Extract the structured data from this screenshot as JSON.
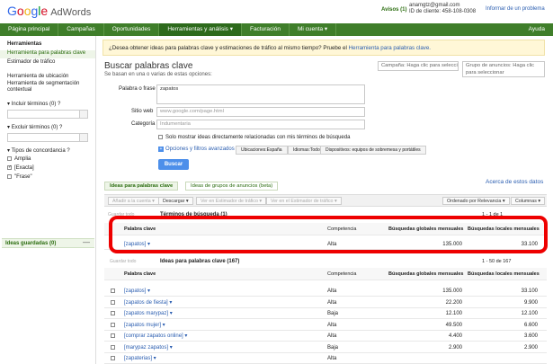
{
  "header": {
    "logo_google": [
      "G",
      "o",
      "o",
      "g",
      "l",
      "e"
    ],
    "logo_product": "AdWords",
    "notices": "Avisos (1)",
    "user_email": "anamgtz@gmail.com",
    "client_id": "ID de cliente: 458-108-0308",
    "report_issue": "Informar de un problema"
  },
  "nav": [
    "Página principal",
    "Campañas",
    "Oportunidades",
    "Herramientas y análisis ▾",
    "Facturación",
    "Mi cuenta ▾",
    "Ayuda"
  ],
  "sidebar": {
    "section_title": "Herramientas",
    "items": [
      "Herramienta para palabras clave",
      "Estimador de tráfico",
      "Herramienta de ubicación",
      "Herramienta de segmentación contextual"
    ],
    "include_terms": "Incluir términos (0)",
    "exclude_terms": "Excluir términos (0)",
    "match_types_title": "Tipos de concordancia",
    "match_types": [
      {
        "label": "Amplia",
        "checked": false
      },
      {
        "label": "[Exacta]",
        "checked": true
      },
      {
        "label": "\"Frase\"",
        "checked": false
      }
    ],
    "saved_ideas": "Ideas guardadas (0)"
  },
  "banner": {
    "text": "¿Desea obtener ideas para palabras clave y estimaciones de tráfico al mismo tiempo? Pruebe el ",
    "link": "Herramienta para palabras clave."
  },
  "campaign_select": "Campaña: Haga clic para seleccionar",
  "adgroup_select": "Grupo de anuncios: Haga clic para seleccionar",
  "search": {
    "title": "Buscar palabras clave",
    "subtitle": "Se basan en una o varias de estas opciones:",
    "keyword_label": "Palabra o frase",
    "keyword_value": "zapatos",
    "website_label": "Sitio web",
    "website_placeholder": "www.google.com/page.html",
    "category_label": "Categoría",
    "category_placeholder": "Indumentaria",
    "only_related": "Solo mostrar ideas directamente relacionadas con mis términos de búsqueda",
    "advanced": "Opciones y filtros avanzados",
    "location_chip": "Ubicaciones:España",
    "language_chip": "Idiomas:Todo",
    "devices_chip": "Dispositivos: equipos de sobremesa y portátiles",
    "button": "Buscar"
  },
  "tabs": {
    "ideas": "Ideas para palabras clave",
    "groups": "Ideas de grupos de anuncios (beta)",
    "about": "Acerca de estos datos"
  },
  "toolbar": {
    "add": "Añadir a la cuenta ▾",
    "download": "Descargar ▾",
    "see_search": "Ver en Estimador de tráfico ▾",
    "see_estimator": "Ver en el Estimador de tráfico ▾",
    "sort": "Ordenado por Relevancia ▾",
    "columns": "Columnas ▾"
  },
  "search_terms": {
    "save_all": "Guardar todo",
    "title": "Términos de búsqueda (1)",
    "pagination": "1 - 1 de 1",
    "columns": [
      "Palabra clave",
      "Competencia",
      "Búsquedas globales mensuales",
      "Búsquedas locales mensuales"
    ],
    "rows": [
      {
        "keyword": "[zapatos] ▾",
        "competition": "Alta",
        "global": "135.000",
        "local": "33.100"
      }
    ]
  },
  "ideas": {
    "save_all": "Guardar todo",
    "title": "Ideas para palabras clave (167)",
    "pagination": "1 - 50 de 167",
    "columns": [
      "Palabra clave",
      "Competencia",
      "Búsquedas globales mensuales",
      "Búsquedas locales mensuales"
    ],
    "rows": [
      {
        "keyword": "[zapatos] ▾",
        "competition": "Alta",
        "global": "135.000",
        "local": "33.100"
      },
      {
        "keyword": "[zapatos de fiesta] ▾",
        "competition": "Alta",
        "global": "22.200",
        "local": "9.900"
      },
      {
        "keyword": "[zapatos marypaz] ▾",
        "competition": "Baja",
        "global": "12.100",
        "local": "12.100"
      },
      {
        "keyword": "[zapatos mujer] ▾",
        "competition": "Alta",
        "global": "49.500",
        "local": "6.600"
      },
      {
        "keyword": "[comprar zapatos online] ▾",
        "competition": "Alta",
        "global": "4.400",
        "local": "3.600"
      },
      {
        "keyword": "[marypaz zapatos] ▾",
        "competition": "Baja",
        "global": "2.900",
        "local": "2.900"
      },
      {
        "keyword": "[zapaterias] ▾",
        "competition": "Alta",
        "global": "",
        "local": ""
      }
    ]
  },
  "colors": {
    "nav": "#3f7e2a",
    "accent_link": "#2a5db0",
    "highlight": "#e00000"
  }
}
